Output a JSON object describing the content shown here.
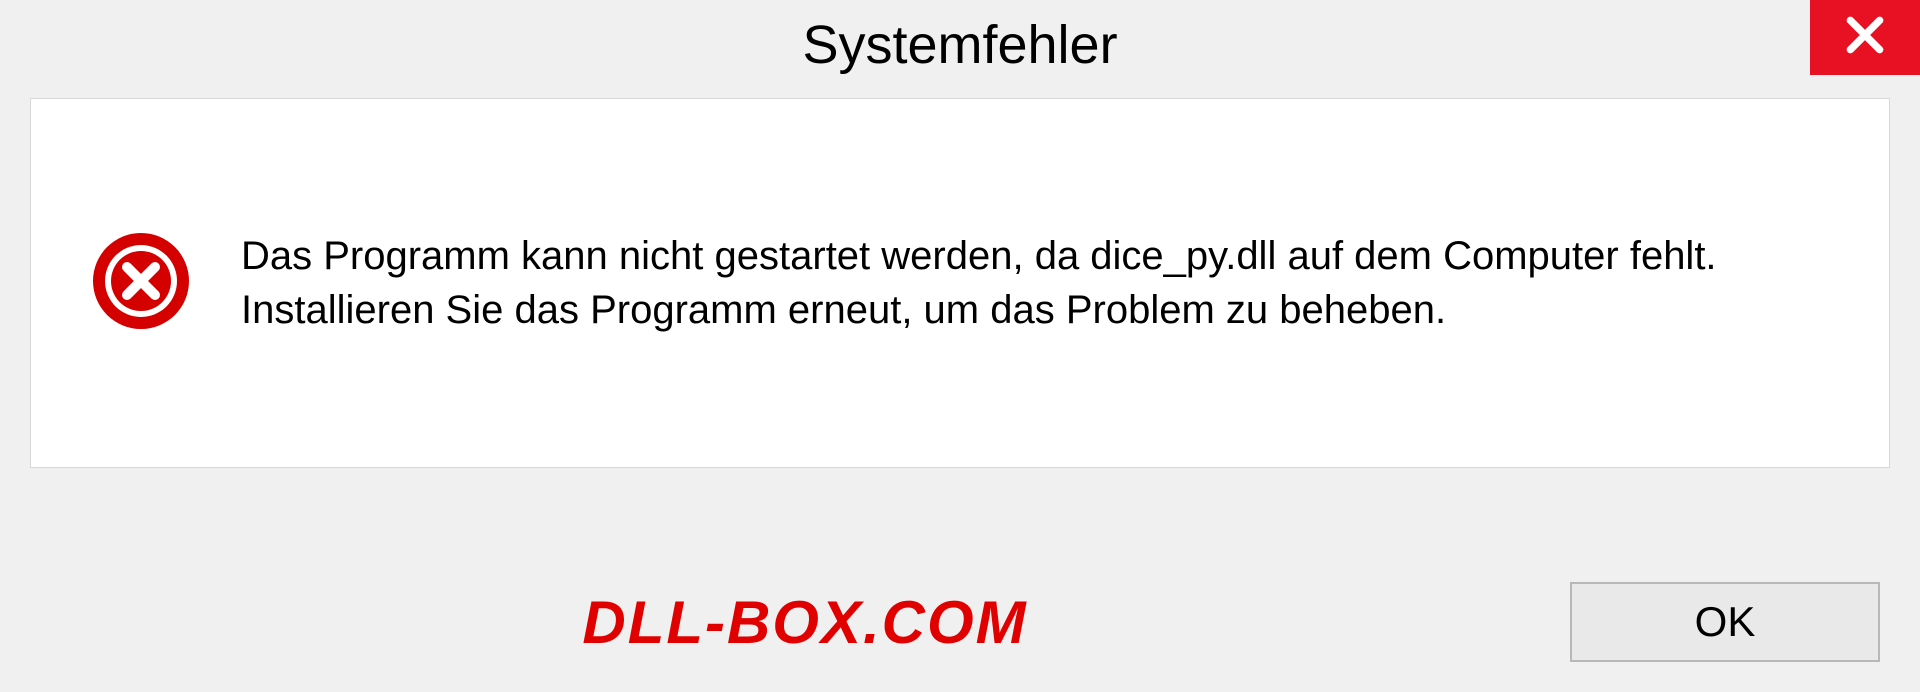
{
  "dialog": {
    "title": "Systemfehler",
    "message": "Das Programm kann nicht gestartet werden, da dice_py.dll auf dem Computer fehlt. Installieren Sie das Programm erneut, um das Problem zu beheben.",
    "ok_label": "OK"
  },
  "watermark": {
    "text": "DLL-BOX.COM"
  },
  "colors": {
    "close_bg": "#e81123",
    "error_icon": "#d40000",
    "watermark": "#e10000"
  }
}
